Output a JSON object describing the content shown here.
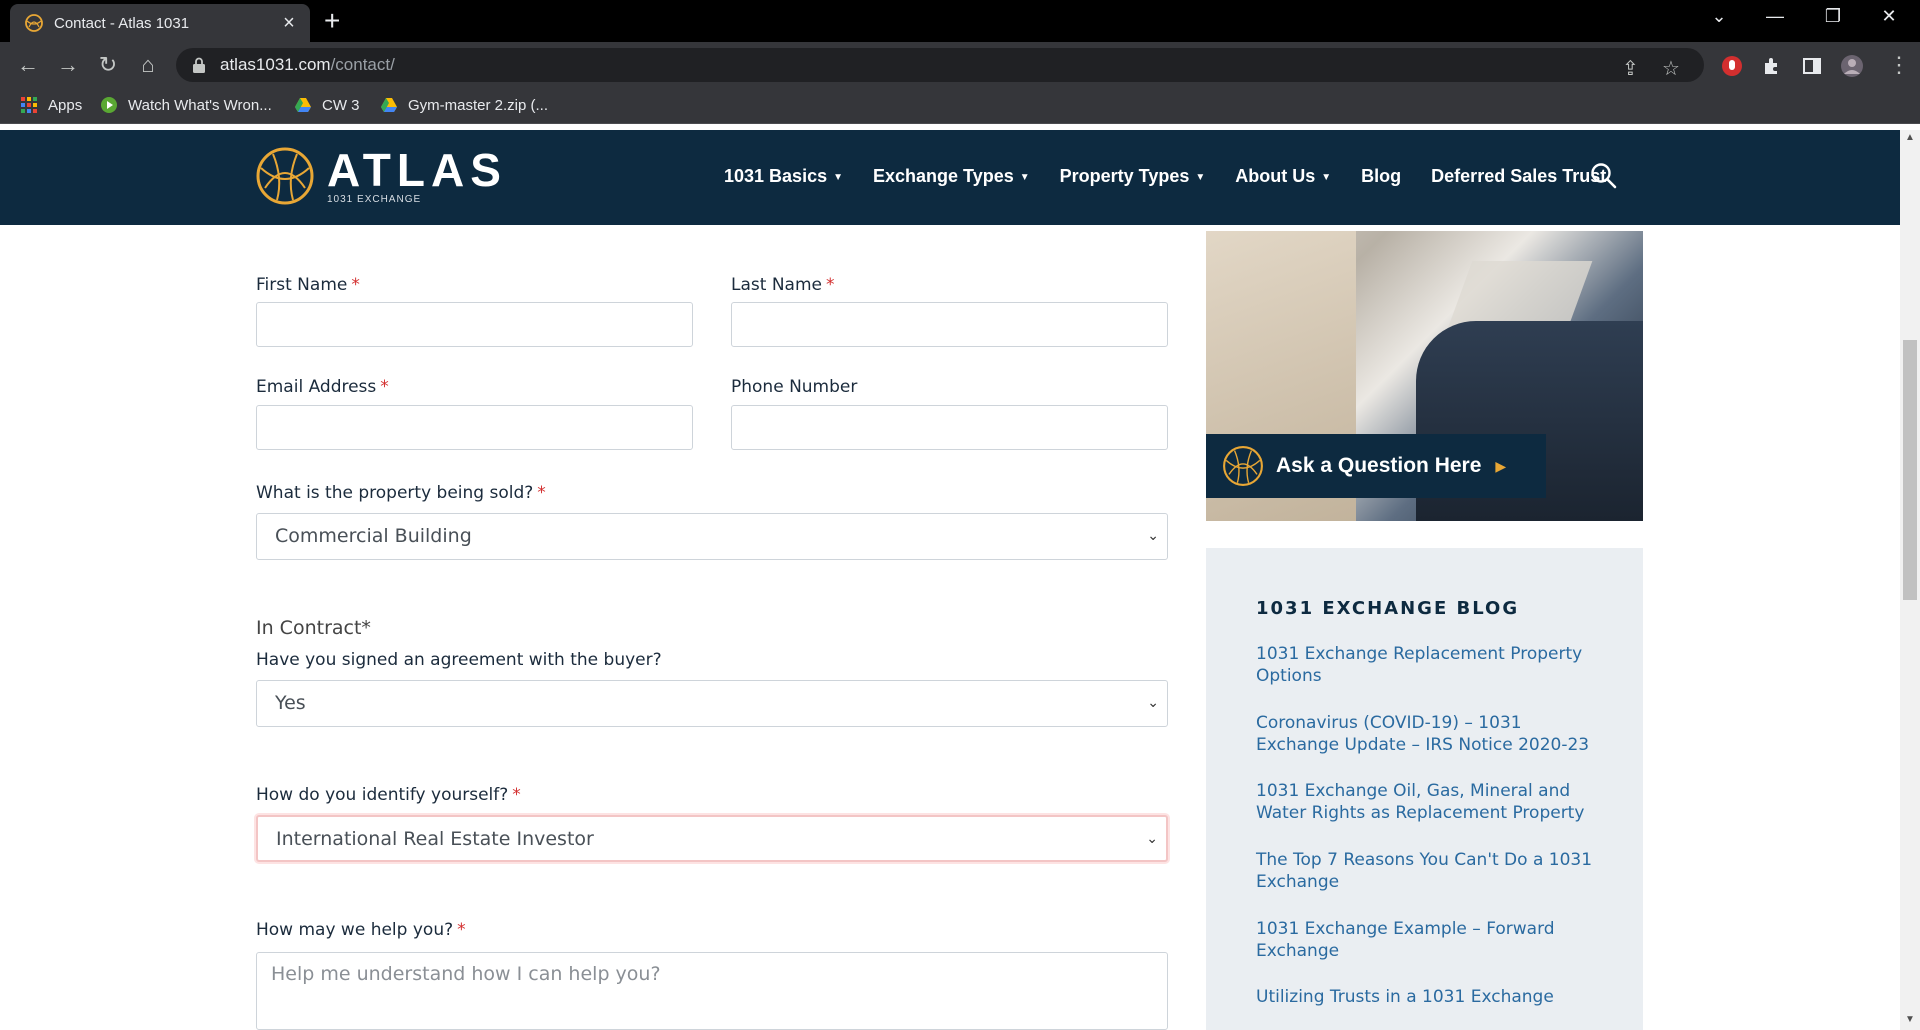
{
  "browser": {
    "tab_title": "Contact - Atlas 1031",
    "url_host": "atlas1031.com",
    "url_path": "/contact/",
    "bookmarks": [
      "Apps",
      "Watch What's Wron...",
      "CW 3",
      "Gym-master 2.zip (..."
    ]
  },
  "site": {
    "logo_text": "ATLAS",
    "logo_sub": "1031 EXCHANGE",
    "nav": [
      {
        "label": "1031 Basics",
        "dropdown": true
      },
      {
        "label": "Exchange Types",
        "dropdown": true
      },
      {
        "label": "Property Types",
        "dropdown": true
      },
      {
        "label": "About Us",
        "dropdown": true
      },
      {
        "label": "Blog",
        "dropdown": false
      },
      {
        "label": "Deferred Sales Trust",
        "dropdown": false
      }
    ],
    "brand_color": "#0d2a40",
    "accent_color": "#e8a735"
  },
  "form": {
    "first_name_label": "First Name",
    "last_name_label": "Last Name",
    "email_label": "Email Address",
    "phone_label": "Phone Number",
    "property_label": "What is the property being sold?",
    "property_value": "Commercial Building",
    "in_contract_label": "In Contract*",
    "agreement_label": "Have you signed an agreement with the buyer?",
    "agreement_value": "Yes",
    "identify_label": "How do you identify yourself?",
    "identify_value": "International Real Estate Investor",
    "help_label": "How may we help you?",
    "help_placeholder": "Help me understand how I can help you?",
    "required_mark": "*"
  },
  "sidebar": {
    "cta_label": "Ask a Question Here",
    "blog_title": "1031 EXCHANGE BLOG",
    "blog_links": [
      "1031 Exchange Replacement Property Options",
      "Coronavirus (COVID-19) – 1031 Exchange Update – IRS Notice 2020-23",
      "1031 Exchange Oil, Gas, Mineral and Water Rights as Replacement Property",
      "The Top 7 Reasons You Can't Do a 1031 Exchange",
      "1031 Exchange Example – Forward Exchange",
      "Utilizing Trusts in a 1031 Exchange"
    ]
  }
}
